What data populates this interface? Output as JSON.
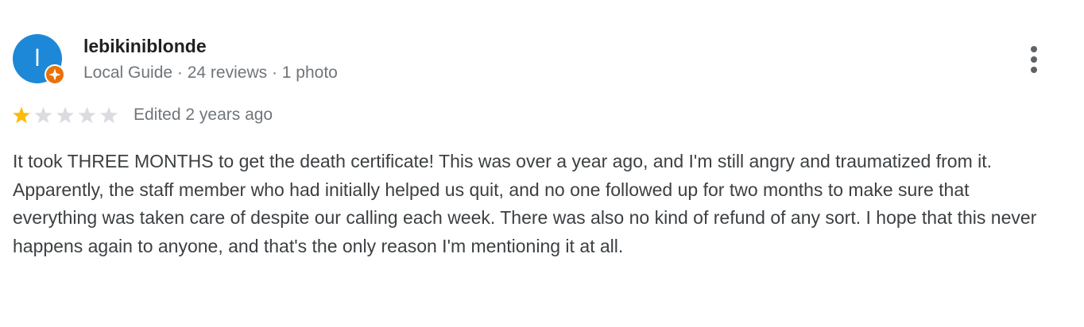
{
  "reviewer": {
    "avatar_initial": "l",
    "avatar_color": "#1e88d8",
    "badge_color": "#e8710a",
    "badge_icon": "local-guide-star-icon",
    "name": "lebikiniblonde",
    "meta": "Local Guide · 24 reviews · 1 photo"
  },
  "menu": {
    "icon": "more-vert-icon"
  },
  "rating": {
    "value": 1,
    "max": 5,
    "filled_color": "#fbbc04",
    "empty_color": "#dadce0",
    "date": "Edited 2 years ago"
  },
  "review": {
    "text": "It took THREE MONTHS to get the death certificate! This was over a year ago, and I'm still angry and traumatized from it. Apparently, the staff member who had initially helped us quit, and no one followed up for two months to make sure that everything was taken care of despite our calling each week. There was also no kind of refund of any sort. I hope that this never happens again to anyone, and that's the only reason I'm mentioning it at all."
  }
}
